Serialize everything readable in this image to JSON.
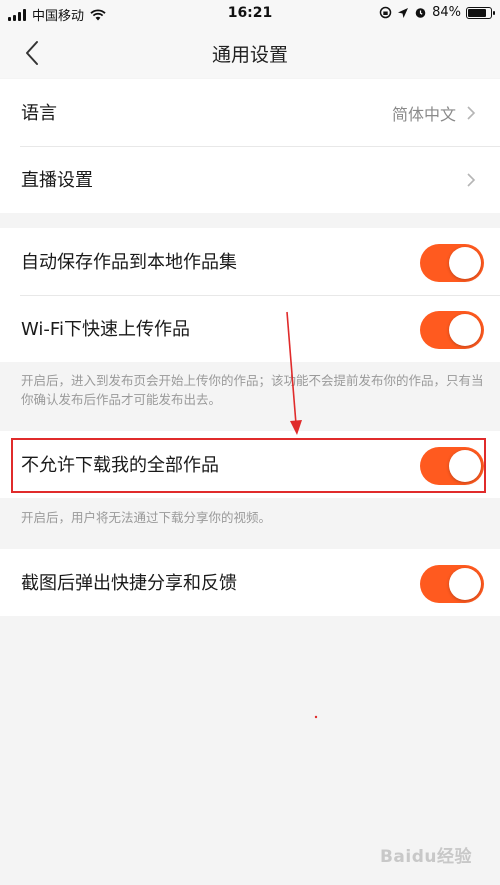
{
  "status_bar": {
    "carrier": "中国移动",
    "time": "16:21",
    "battery": "84%",
    "battery_level": 0.84
  },
  "nav": {
    "title": "通用设置"
  },
  "settings": {
    "language_label": "语言",
    "language_value": "简体中文",
    "live_label": "直播设置",
    "auto_save_label": "自动保存作品到本地作品集",
    "auto_save_on": true,
    "wifi_upload_label": "Wi-Fi下快速上传作品",
    "wifi_upload_on": true,
    "upload_note": "开启后，进入到发布页会开始上传你的作品；该功能不会提前发布你的作品，只有当你确认发布后作品才可能发布出去。",
    "no_download_label": "不允许下载我的全部作品",
    "no_download_on": true,
    "download_note": "开启后，用户将无法通过下载分享你的视频。",
    "screenshot_share_label": "截图后弹出快捷分享和反馈",
    "screenshot_share_on": true
  },
  "colors": {
    "toggle_on": "#ff5a1f",
    "annotation_red": "#e02b2b"
  },
  "watermark": "Baidu经验"
}
